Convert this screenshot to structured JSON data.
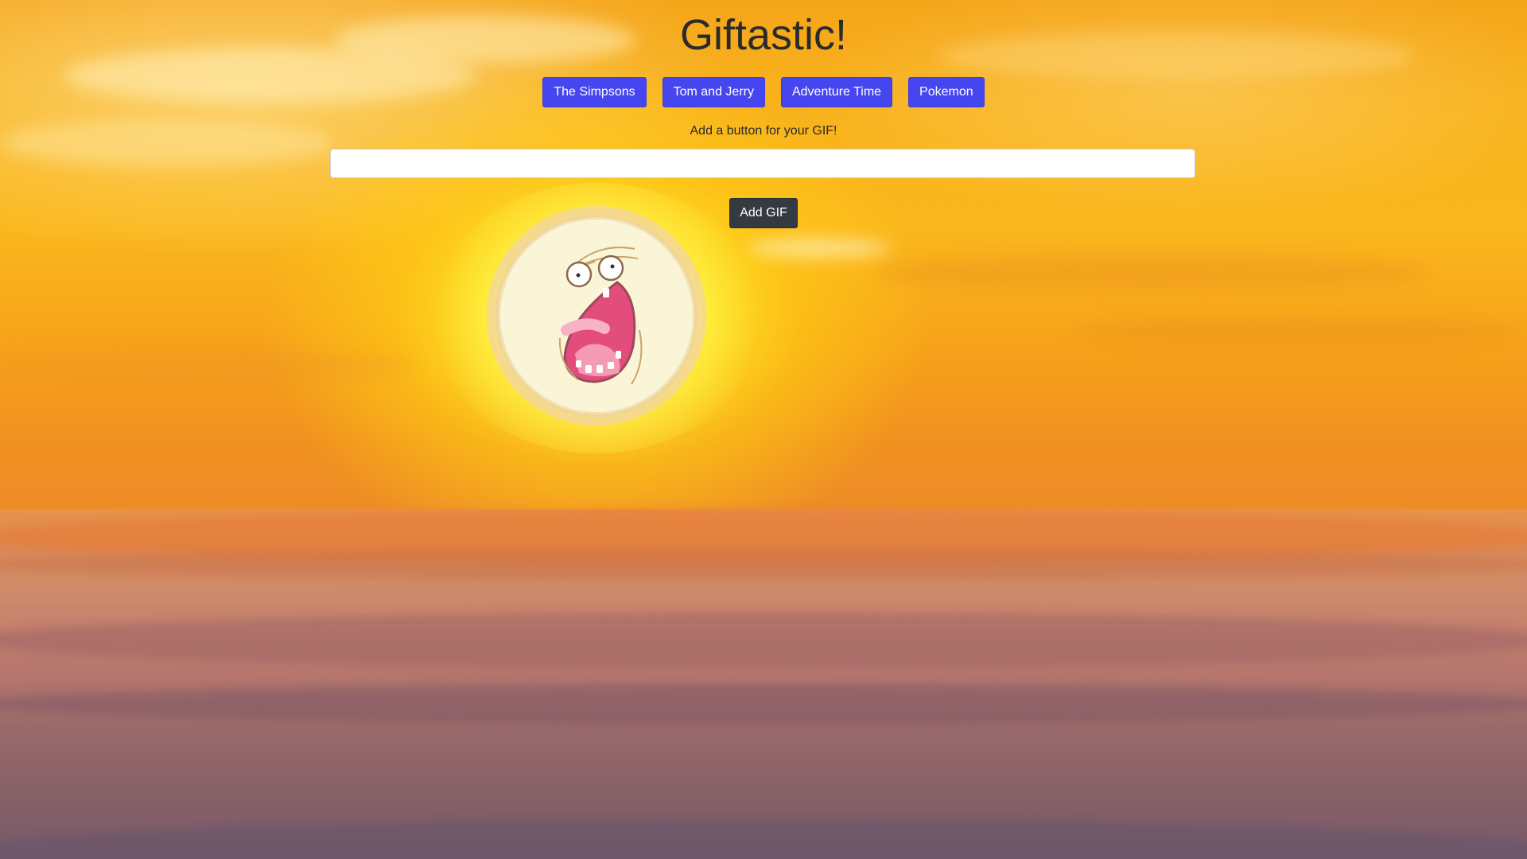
{
  "app": {
    "title": "Giftastic!"
  },
  "topics": [
    {
      "label": "The Simpsons"
    },
    {
      "label": "Tom and Jerry"
    },
    {
      "label": "Adventure Time"
    },
    {
      "label": "Pokemon"
    }
  ],
  "form": {
    "prompt": "Add a button for your GIF!",
    "input_value": "",
    "input_placeholder": "",
    "submit_label": "Add GIF"
  },
  "theme": {
    "topic_button_color": "#4646f0",
    "submit_button_color": "#343a40",
    "title_color": "#2b2b2b"
  },
  "background": {
    "icon": "sunset-ocean-background",
    "sun_icon": "screaming-sun-face-icon"
  }
}
